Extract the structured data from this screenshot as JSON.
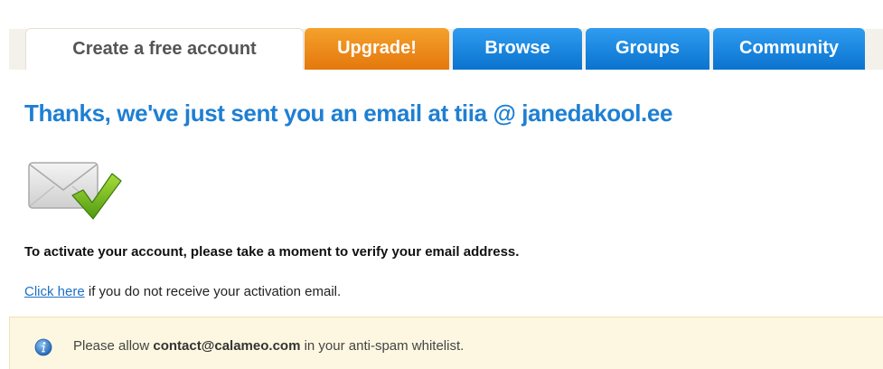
{
  "tabs": [
    {
      "label": "Create a free account",
      "state": "active"
    },
    {
      "label": "Upgrade!",
      "state": "orange"
    },
    {
      "label": "Browse",
      "state": "blue"
    },
    {
      "label": "Groups",
      "state": "blue"
    },
    {
      "label": "Community",
      "state": "blue"
    }
  ],
  "confirmation": {
    "headline": "Thanks, we've just sent you an email at  tiia @ janedakool.ee",
    "icon": "email-sent-check-icon",
    "instruction": "To activate your account, please take a moment to verify your email address.",
    "resend_link": "Click here",
    "resend_text": " if you do not receive your activation email."
  },
  "notice": {
    "icon": "info-icon",
    "prefix": "Please allow ",
    "email": "contact@calameo.com",
    "suffix": " in your anti-spam whitelist."
  },
  "colors": {
    "headline": "#1e7fd3",
    "tab_orange": "#e4780c",
    "tab_blue": "#0a73cf",
    "notice_bg": "#fdf7e1"
  }
}
